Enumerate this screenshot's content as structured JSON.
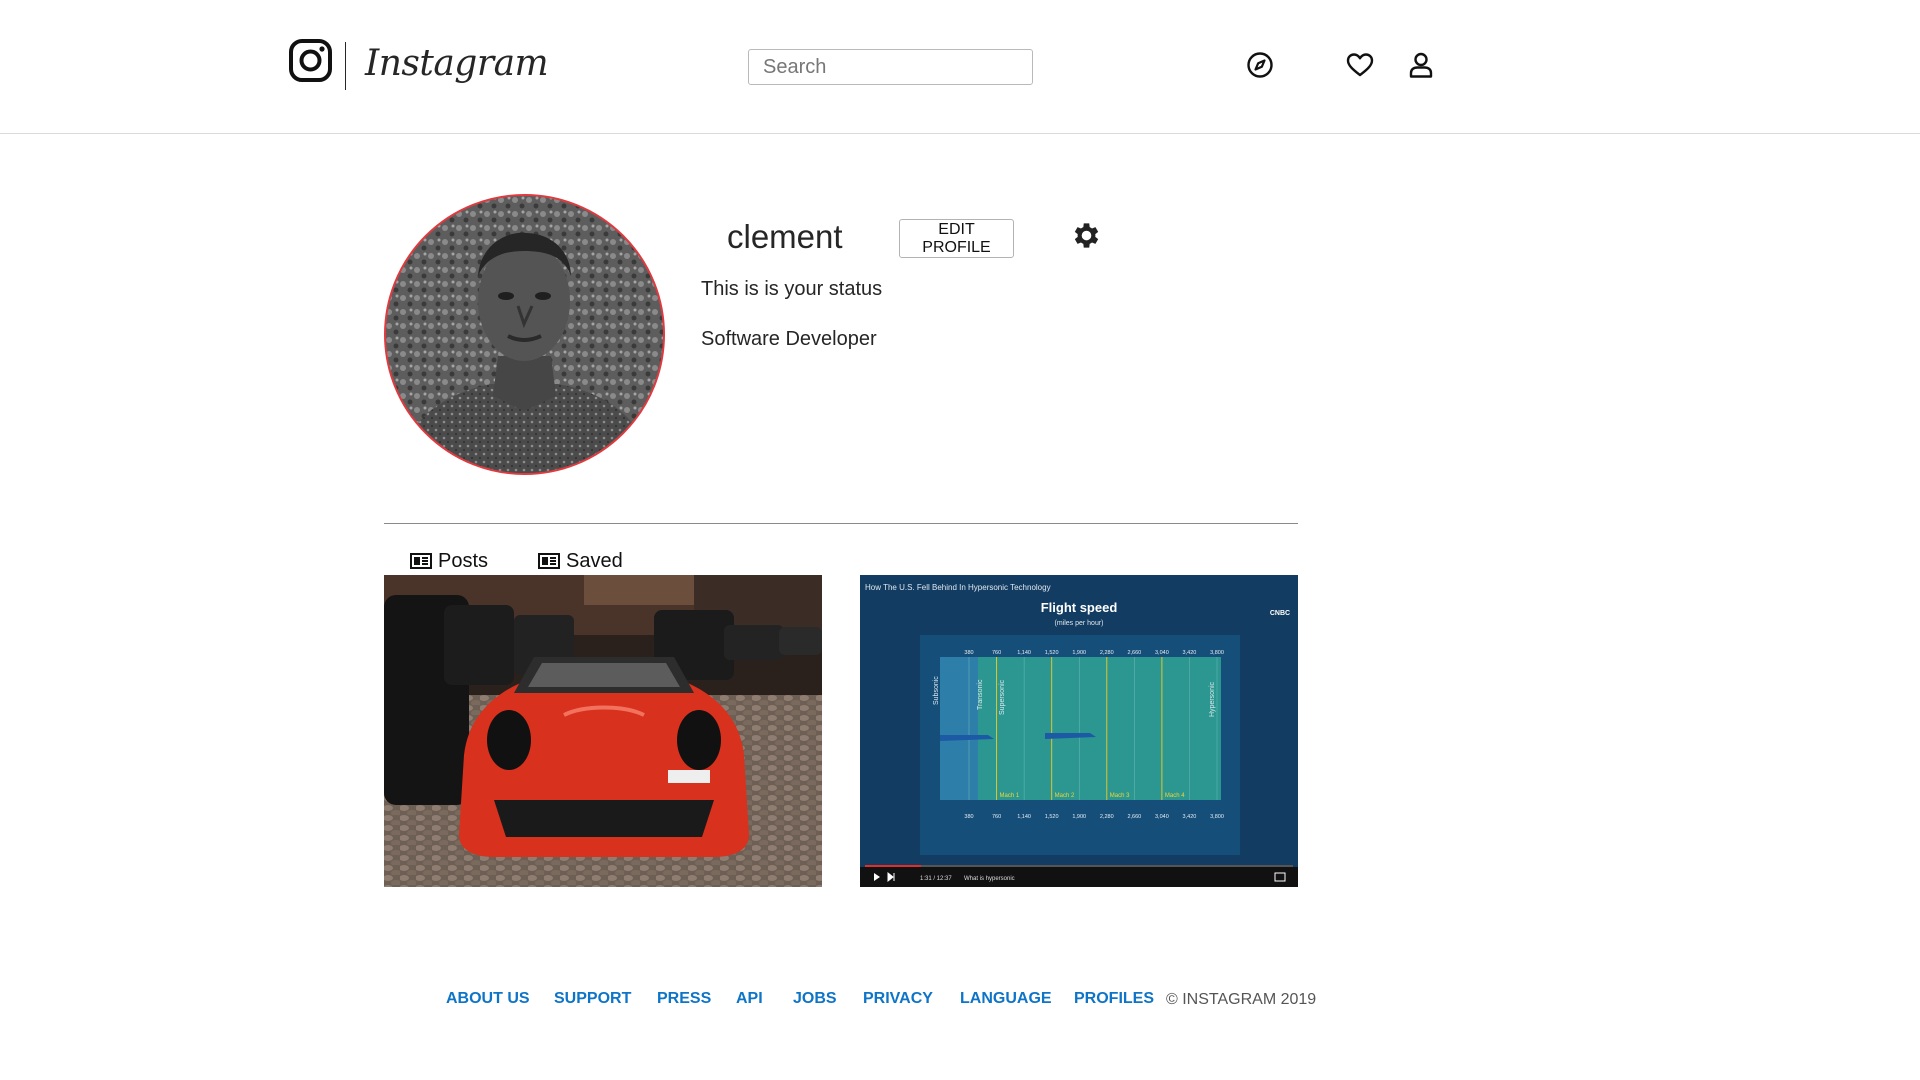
{
  "header": {
    "brand": "Instagram",
    "search_placeholder": "Search",
    "icons": [
      "compass-icon",
      "heart-icon",
      "user-icon"
    ]
  },
  "profile": {
    "username": "clement",
    "edit_label": "EDIT PROFILE",
    "status": "This is is your status",
    "occupation": "Software Developer"
  },
  "tabs": [
    {
      "label": "Posts",
      "icon": "card-icon"
    },
    {
      "label": "Saved",
      "icon": "card-icon"
    }
  ],
  "posts": [
    {
      "kind": "photo",
      "subject": "red sports car"
    },
    {
      "kind": "video-still",
      "video_title": "How The U.S. Fell Behind In Hypersonic Technology",
      "heading": "Flight speed",
      "subheading": "(miles per hour)",
      "speed_ticks": [
        "380",
        "760",
        "1,140",
        "1,520",
        "1,900",
        "2,280",
        "2,660",
        "3,040",
        "3,420",
        "3,800"
      ],
      "regimes": [
        "Subsonic",
        "Transonic",
        "Supersonic",
        "Hypersonic"
      ],
      "mach_labels": [
        "Mach 1",
        "Mach 2",
        "Mach 3",
        "Mach 4"
      ],
      "time": "1:31 / 12:37",
      "chapter": "What is hypersonic",
      "logo": "CNBC"
    }
  ],
  "footer": {
    "links": [
      "ABOUT US",
      "SUPPORT",
      "PRESS",
      "API",
      "JOBS",
      "PRIVACY",
      "LANGUAGE",
      "PROFILES"
    ],
    "copyright": "© INSTAGRAM 2019"
  },
  "colors": {
    "link": "#0d74c7",
    "avatar_ring": "#e0393e",
    "chart_bg": "#124a73"
  }
}
